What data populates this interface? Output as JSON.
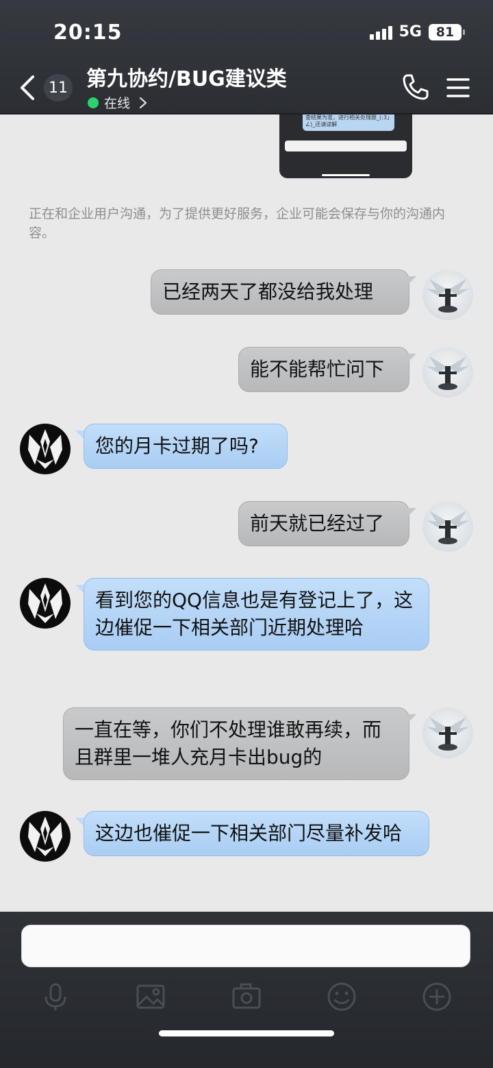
{
  "status_bar": {
    "time": "20:15",
    "network": "5G",
    "battery": "81"
  },
  "header": {
    "unread_count": "11",
    "title": "第九协约/BUG建议类",
    "status": "在线"
  },
  "chat": {
    "shared_image_text": "查结果为准，进行相关处理跟_(:3」∠)_还请谅解",
    "notice": "正在和企业用户沟通，为了提供更好服务，企业可能会保存与你的沟通内容。",
    "messages": [
      {
        "sender": "me",
        "text": "已经两天了都没给我处理"
      },
      {
        "sender": "me",
        "text": "能不能帮忙问下"
      },
      {
        "sender": "them",
        "text": "您的月卡过期了吗?"
      },
      {
        "sender": "me",
        "text": "前天就已经过了"
      },
      {
        "sender": "them",
        "text": "看到您的QQ信息也是有登记上了，这边催促一下相关部门近期处理哈"
      },
      {
        "sender": "me",
        "text": "一直在等，你们不处理谁敢再续，而且群里一堆人充月卡出bug的"
      },
      {
        "sender": "them",
        "text": "这边也催促一下相关部门尽量补发哈"
      }
    ]
  },
  "input_bar": {
    "value": "",
    "tools": [
      "microphone-icon",
      "image-icon",
      "camera-icon",
      "emoji-icon",
      "plus-icon"
    ]
  },
  "colors": {
    "header_bg": "#2f3237",
    "my_bubble": "#bfc1c3",
    "their_bubble": "#b6d6f7",
    "online_dot": "#2bd36a"
  }
}
